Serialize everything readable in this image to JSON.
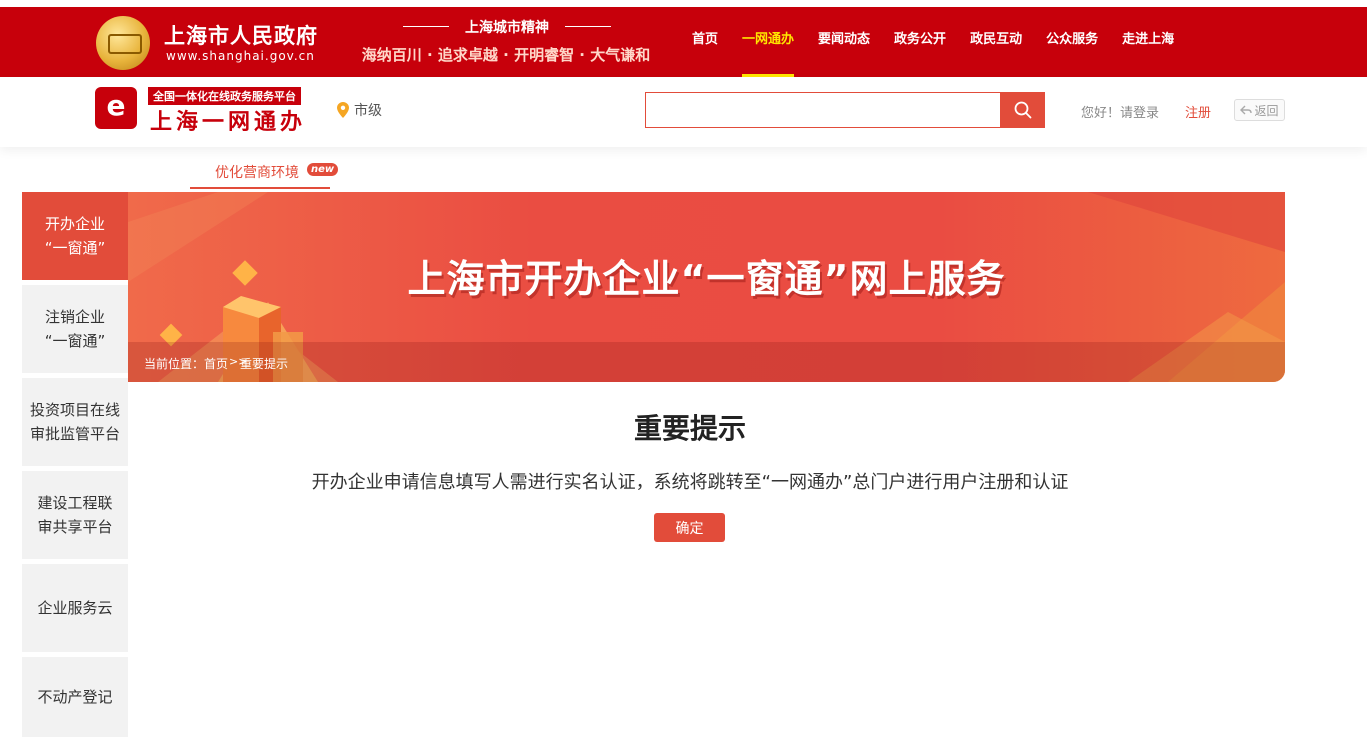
{
  "gov": {
    "title": "上海市人民政府",
    "url": "www.shanghai.gov.cn",
    "spirit_title": "上海城市精神",
    "spirit_motto": "海纳百川 · 追求卓越 · 开明睿智 · 大气谦和"
  },
  "topnav": {
    "items": [
      "首页",
      "一网通办",
      "要闻动态",
      "政务公开",
      "政民互动",
      "公众服务",
      "走进上海"
    ],
    "active": "一网通办"
  },
  "header": {
    "platform_subtitle": "全国一体化在线政务服务平台",
    "platform_name": "上海一网通办",
    "region_label": "市级",
    "search_value": "",
    "greeting": "您好！请登录",
    "register_label": "注册",
    "back_label": "返回"
  },
  "subtab": {
    "label": "优化营商环境",
    "badge": "new"
  },
  "banner": {
    "title": "上海市开办企业“一窗通”网上服务",
    "breadcrumb_label": "当前位置：",
    "breadcrumb_home": "首页",
    "breadcrumb_sep": ">>",
    "breadcrumb_current": "重要提示"
  },
  "sidebar": {
    "items": [
      {
        "line1": "开办企业",
        "line2": "“一窗通”",
        "active": true
      },
      {
        "line1": "注销企业",
        "line2": "“一窗通”",
        "active": false
      },
      {
        "line1": "投资项目在线",
        "line2": "审批监管平台",
        "active": false
      },
      {
        "line1": "建设工程联",
        "line2": "审共享平台",
        "active": false
      },
      {
        "line1": "企业服务云",
        "line2": "",
        "active": false
      },
      {
        "line1": "不动产登记",
        "line2": "",
        "active": false
      }
    ]
  },
  "notice": {
    "title": "重要提示",
    "message": "开办企业申请信息填写人需进行实名认证，系统将跳转至“一网通办”总门户进行用户注册和认证",
    "confirm_label": "确定"
  },
  "colors": {
    "gov_red": "#c7000b",
    "accent": "#e24c3a",
    "nav_active": "#ffe600"
  }
}
